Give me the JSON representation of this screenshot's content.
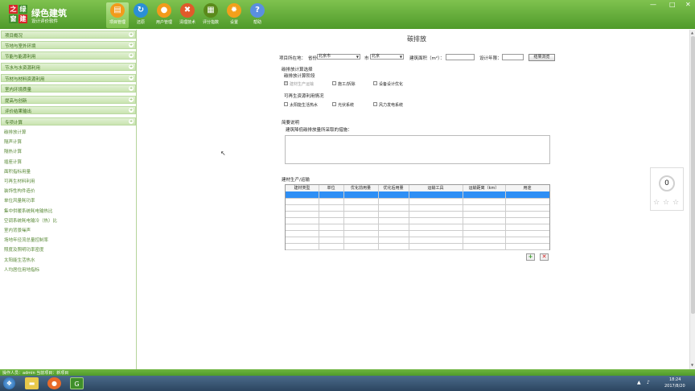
{
  "app": {
    "logo_chars": [
      "之",
      "绿",
      "窗",
      "建"
    ],
    "title": "绿色建筑",
    "subtitle": "设计评价软件",
    "window_controls": [
      "—",
      "□",
      "✕"
    ]
  },
  "nav": [
    {
      "label": "项目管理",
      "icon": "folder-icon",
      "glyph": "▤",
      "color": "#f29b1b",
      "active": true
    },
    {
      "label": "还原",
      "icon": "refresh-icon",
      "glyph": "↻",
      "color": "#2b8fd6",
      "active": false
    },
    {
      "label": "用户管理",
      "icon": "user-icon",
      "glyph": "●",
      "color": "#f29b1b",
      "active": false
    },
    {
      "label": "清理技术",
      "icon": "clean-icon",
      "glyph": "✖",
      "color": "#e05a2a",
      "active": false
    },
    {
      "label": "评分指数",
      "icon": "score-icon",
      "glyph": "▦",
      "color": "#5a8a1a",
      "active": false
    },
    {
      "label": "设置",
      "icon": "gear-icon",
      "glyph": "✹",
      "color": "#f2a01b",
      "active": false
    },
    {
      "label": "帮助",
      "icon": "help-icon",
      "glyph": "?",
      "color": "#5a8fe0",
      "active": false
    }
  ],
  "sidebar": {
    "groups": [
      "项目概况",
      "节地与室外环境",
      "节能与能源利用",
      "节水与水资源利用",
      "节材与材料资源利用",
      "室内环境质量",
      "提高与创新",
      "评价结果输出",
      "专项计算"
    ],
    "items": [
      "碳排放计算",
      "隔声计算",
      "隔热计算",
      "插座计算",
      "面积指标用量",
      "可再生材料利用",
      "装饰性构件造价",
      "单位风量耗功率",
      "集中供暖系统耗电输热比",
      "空调系统耗电输冷（热）比",
      "室内背景噪声",
      "场地年径流总量控制率",
      "照度及照明功率密度",
      "太阳能生活热水",
      "人均居住用地指标"
    ]
  },
  "page": {
    "title": "碳排放",
    "location_label": "项目所在地：",
    "province_label": "省份",
    "province_value": "北京市",
    "city_label": "市",
    "city_value": "北京",
    "area_label": "建筑面积（m²）：",
    "area_value": "",
    "years_label": "设计年限：",
    "years_value": "",
    "result_button": "结果浏览",
    "section_calc": "碳排放计算选择",
    "section_stage": "碳排放计算阶段",
    "stages": [
      {
        "label": "建材生产运输",
        "checked": true,
        "disabled": true
      },
      {
        "label": "施工/拆除",
        "checked": false,
        "disabled": false
      },
      {
        "label": "设备设计优化",
        "checked": false,
        "disabled": false
      }
    ],
    "section_renew": "可再生资源利用情况",
    "renewables": [
      {
        "label": "太阳能生活热水",
        "checked": false
      },
      {
        "label": "光伏系统",
        "checked": false
      },
      {
        "label": "风力发电系统",
        "checked": false
      }
    ],
    "section_desc": "简要说明",
    "desc_label": "建筑降低碳排放量所采取的措施：",
    "desc_value": "",
    "section_material": "建材生产/运输",
    "table_headers": [
      "建材类型",
      "单位",
      "优化前用量",
      "优化后用量",
      "运输工具",
      "运输距离（km）",
      "用途"
    ],
    "add_button": "+",
    "delete_button": "✕"
  },
  "rating": {
    "score": "0",
    "stars": [
      "☆",
      "☆",
      "☆"
    ]
  },
  "status": {
    "text": "操作人员：admin  当前项目：新项目"
  },
  "taskbar": {
    "time": "18:24",
    "date": "2017/8/20"
  }
}
